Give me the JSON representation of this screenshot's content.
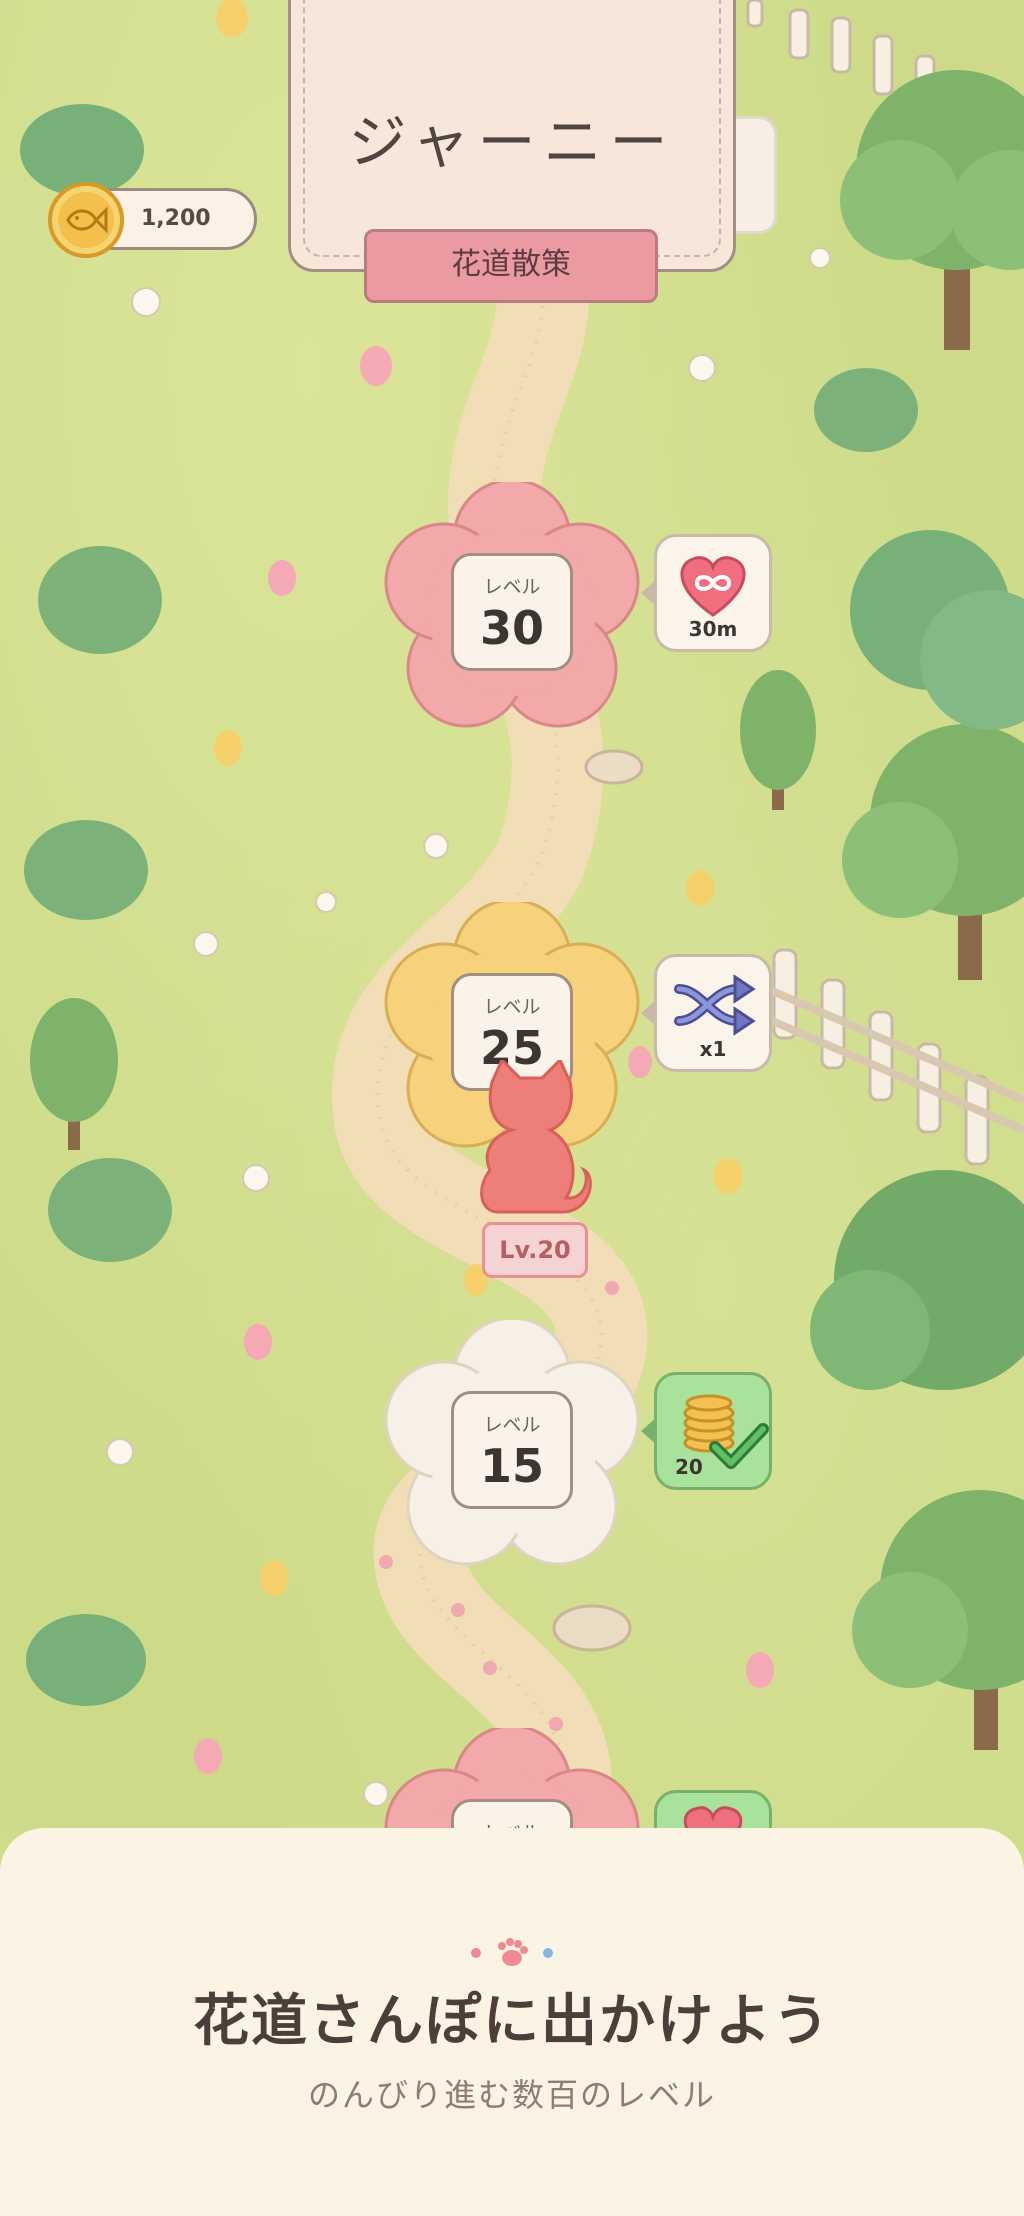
{
  "header": {
    "title": "ジャーニー",
    "subtitle_chip": "花道散策"
  },
  "currency": {
    "icon": "fish-coin-icon",
    "amount": "1,200"
  },
  "levels": [
    {
      "label": "レベル",
      "number": "30",
      "color": "#f3a9a9",
      "reward": {
        "icon": "infinite-heart-icon",
        "text": "30m",
        "claimed": false
      }
    },
    {
      "label": "レベル",
      "number": "25",
      "color": "#f6d27c",
      "reward": {
        "icon": "shuffle-icon",
        "text": "x1",
        "claimed": false
      }
    },
    {
      "label": "レベル",
      "number": "15",
      "color": "#f7f0e6",
      "reward": {
        "icon": "coin-stack-icon",
        "text": "20",
        "claimed": true
      }
    },
    {
      "label": "レベル",
      "color": "#f3a9a9"
    }
  ],
  "player": {
    "avatar": "red-cat-icon",
    "level_text": "Lv.20"
  },
  "promo": {
    "headline": "花道さんぽに出かけよう",
    "subline": "のんびり進む数百のレベル"
  },
  "colors": {
    "grass": "#cddb88",
    "path": "#f1ddb6",
    "accent_pink": "#ec9aa2",
    "panel": "#fbf4e4"
  }
}
